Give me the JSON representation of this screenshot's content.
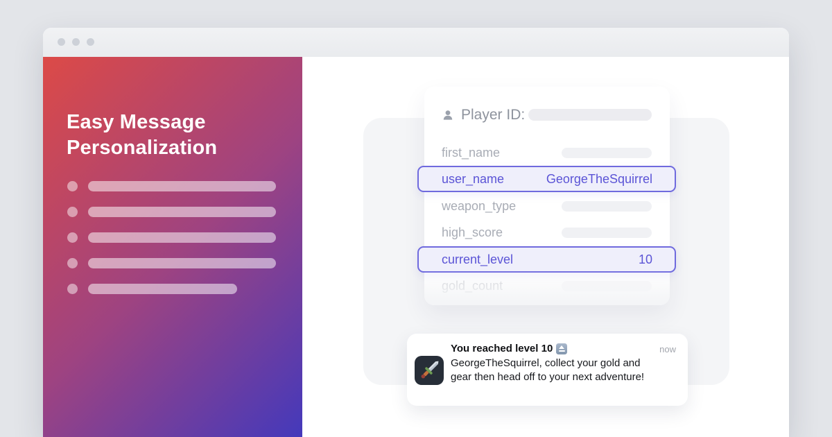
{
  "window": {
    "type": "browser-mockup",
    "traffic_light_count": 3
  },
  "panel": {
    "title_line1": "Easy Message",
    "title_line2": "Personalization",
    "bullets": [
      "long",
      "long",
      "long",
      "long",
      "short"
    ]
  },
  "card": {
    "header": {
      "icon": "person-icon",
      "label": "Player ID:",
      "value_placeholder": true
    },
    "rows": [
      {
        "label": "first_name",
        "value": "",
        "highlighted": false,
        "placeholder": true
      },
      {
        "label": "user_name",
        "value": "GeorgeTheSquirrel",
        "highlighted": true,
        "placeholder": false
      },
      {
        "label": "weapon_type",
        "value": "",
        "highlighted": false,
        "placeholder": true
      },
      {
        "label": "high_score",
        "value": "",
        "highlighted": false,
        "placeholder": true
      },
      {
        "label": "current_level",
        "value": "10",
        "highlighted": true,
        "placeholder": false
      },
      {
        "label": "gold_count",
        "value": "",
        "highlighted": false,
        "placeholder": true,
        "faded": true
      }
    ]
  },
  "notification": {
    "app_icon": "dagger-icon",
    "title": "You reached level 10",
    "title_badge_icon": "level-up-icon",
    "timestamp": "now",
    "body": "GeorgeTheSquirrel, collect your gold and gear then head off to your next adventure!"
  },
  "colors": {
    "page_background": "#e3e5e9",
    "panel_gradient_start": "#dc4a47",
    "panel_gradient_mid": "#9e4381",
    "panel_gradient_end": "#4439bb",
    "highlight_border": "#6f6ade",
    "highlight_bg": "#efeffb",
    "highlight_text": "#5b54d6",
    "label_gray": "#a8acb5",
    "header_gray": "#8e939d",
    "backdrop": "#f4f5f7",
    "app_icon_bg": "#272e38"
  }
}
